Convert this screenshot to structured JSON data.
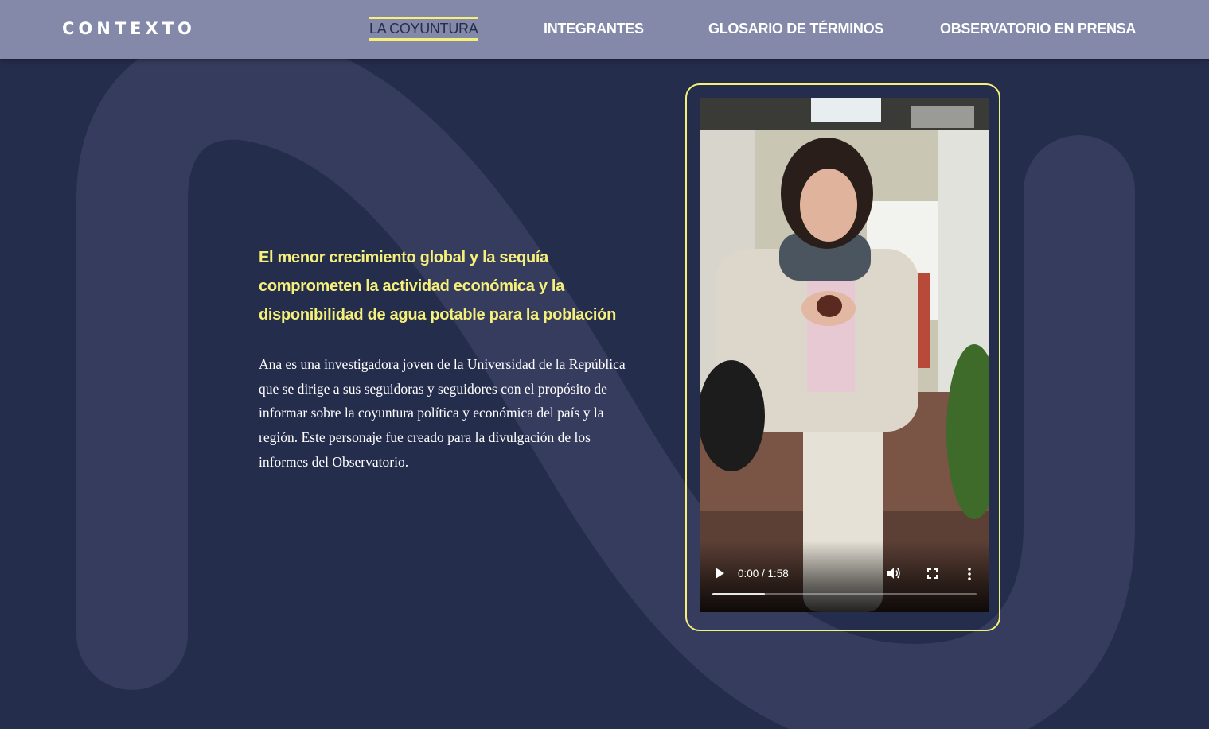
{
  "header": {
    "logo": "CONTEXTO",
    "nav": [
      {
        "label": "LA COYUNTURA",
        "active": true
      },
      {
        "label": "INTEGRANTES",
        "active": false
      },
      {
        "label": "GLOSARIO DE TÉRMINOS",
        "active": false
      },
      {
        "label": "OBSERVATORIO EN PRENSA",
        "active": false
      }
    ]
  },
  "main": {
    "headline": "El menor crecimiento global y la sequía comprometen la actividad económica y la disponibilidad de agua potable para la población",
    "body": "Ana es una investigadora joven de la Universidad de la República que se dirige a sus seguidoras y seguidores con el propósito de informar sobre la coyuntura política y económica del país y la región. Este personaje fue creado para la divulgación de los informes del Observatorio."
  },
  "video": {
    "time": "0:00 / 1:58",
    "buffered_fraction": 0.2,
    "icons": [
      "play-icon",
      "volume-icon",
      "fullscreen-icon",
      "more-options-icon"
    ]
  },
  "colors": {
    "background": "#252d4d",
    "header": "#8489a9",
    "accent": "#f5f07a",
    "shape": "#363c5d"
  }
}
